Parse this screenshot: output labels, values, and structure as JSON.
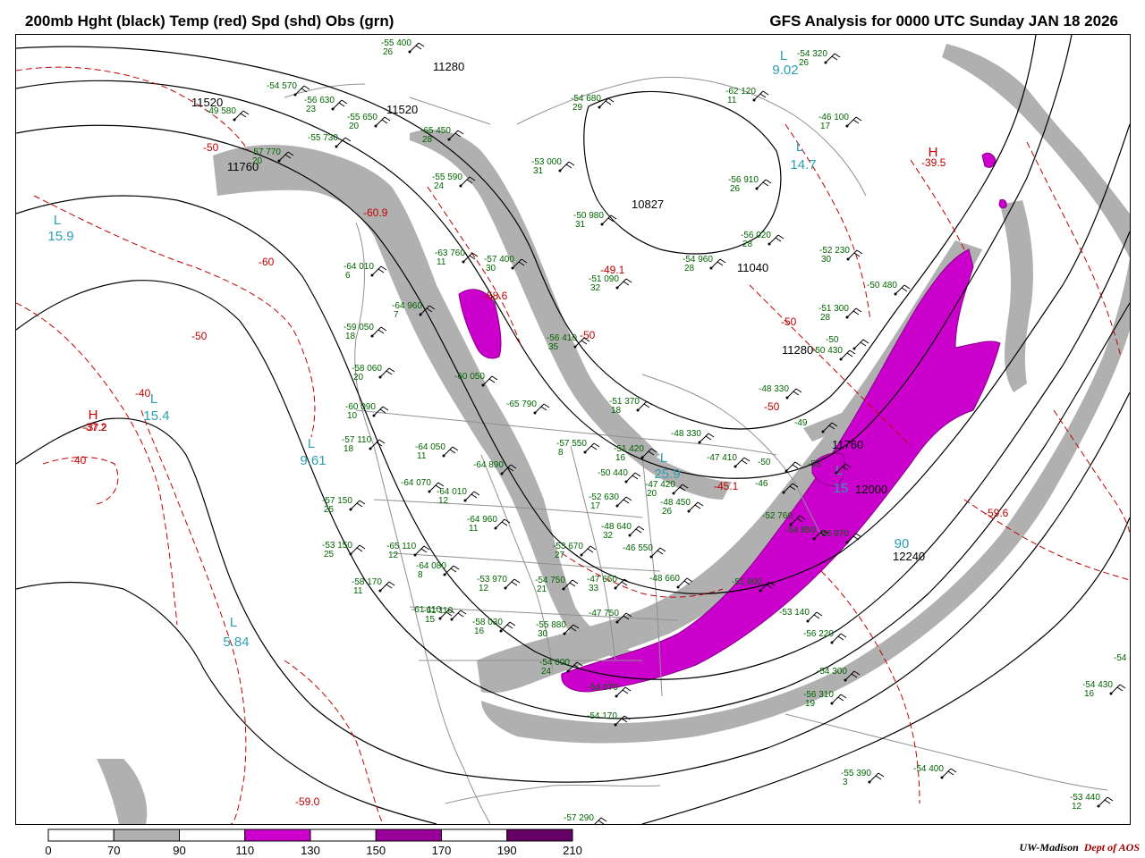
{
  "title_left": "200mb Hght (black) Temp (red) Spd (shd) Obs (grn)",
  "title_right": "GFS Analysis for 0000 UTC Sunday  JAN 18 2026",
  "credit": {
    "org": "UW-Madison",
    "dept": "Dept of AOS"
  },
  "colors": {
    "height": "#000000",
    "temp": "#c00000",
    "obs": "#006400",
    "low_high": "#2aa0b0",
    "shade_70": "#b0b0b0",
    "shade_110": "#cc00cc",
    "shade_150": "#990099",
    "shade_190": "#660066"
  },
  "colorbar": {
    "ticks": [
      "0",
      "70",
      "90",
      "110",
      "130",
      "150",
      "170",
      "190",
      "210"
    ],
    "fills": [
      "#ffffff",
      "#b0b0b0",
      "#ffffff",
      "#cc00cc",
      "#ffffff",
      "#990099",
      "#ffffff",
      "#660066"
    ]
  },
  "height_labels": [
    "11280",
    "11520",
    "11520",
    "11760",
    "10827",
    "11040",
    "11280",
    "11760",
    "12000",
    "12240"
  ],
  "temp_labels": [
    "-50",
    "-60",
    "-50",
    "-40",
    "-40",
    "-50",
    "-50",
    "-37.2",
    "-39.5",
    "-59.6",
    "-45.1",
    "-59.0",
    "-60.9",
    "-58.6",
    "-50",
    "-49.1"
  ],
  "lows_highs": [
    {
      "letter": "L",
      "value": "15.9"
    },
    {
      "letter": "L",
      "value": "15.4"
    },
    {
      "letter": "L",
      "value": "9.61"
    },
    {
      "letter": "L",
      "value": "5.84"
    },
    {
      "letter": "L",
      "value": "14.7"
    },
    {
      "letter": "L",
      "value": "9.02"
    },
    {
      "letter": "L",
      "value": "25.9"
    },
    {
      "letter": "L",
      "value": "15"
    },
    {
      "letter": "L",
      "value": "90"
    },
    {
      "letter": "H",
      "value": "-37.2"
    },
    {
      "letter": "H",
      "value": "-39.5"
    }
  ],
  "obs": [
    {
      "temp": "-55",
      "hgt": "400",
      "dew": "26"
    },
    {
      "temp": "-54",
      "hgt": "570",
      "dew": ""
    },
    {
      "temp": "-56",
      "hgt": "630",
      "dew": "23"
    },
    {
      "temp": "-49",
      "hgt": "580",
      "dew": ""
    },
    {
      "temp": "-55",
      "hgt": "650",
      "dew": "20"
    },
    {
      "temp": "-55",
      "hgt": "730",
      "dew": ""
    },
    {
      "temp": "-57",
      "hgt": "770",
      "dew": "20"
    },
    {
      "temp": "-65",
      "hgt": "450",
      "dew": "28"
    },
    {
      "temp": "-55",
      "hgt": "590",
      "dew": "24"
    },
    {
      "temp": "-53",
      "hgt": "000",
      "dew": "31"
    },
    {
      "temp": "-54",
      "hgt": "680",
      "dew": "29"
    },
    {
      "temp": "-62",
      "hgt": "120",
      "dew": "11"
    },
    {
      "temp": "-54",
      "hgt": "320",
      "dew": "26"
    },
    {
      "temp": "-46",
      "hgt": "100",
      "dew": "17"
    },
    {
      "temp": "-56",
      "hgt": "910",
      "dew": "26"
    },
    {
      "temp": "-50",
      "hgt": "980",
      "dew": "31"
    },
    {
      "temp": "-56",
      "hgt": "020",
      "dew": "28"
    },
    {
      "temp": "-52",
      "hgt": "230",
      "dew": "30"
    },
    {
      "temp": "-54",
      "hgt": "960",
      "dew": "28"
    },
    {
      "temp": "-51",
      "hgt": "090",
      "dew": "32"
    },
    {
      "temp": "-63",
      "hgt": "760",
      "dew": "11"
    },
    {
      "temp": "-57",
      "hgt": "400",
      "dew": "30"
    },
    {
      "temp": "-64",
      "hgt": "010",
      "dew": "6"
    },
    {
      "temp": "-64",
      "hgt": "960",
      "dew": "7"
    },
    {
      "temp": "-59",
      "hgt": "050",
      "dew": "18"
    },
    {
      "temp": "-58",
      "hgt": "060",
      "dew": "20"
    },
    {
      "temp": "-60",
      "hgt": "090",
      "dew": "10"
    },
    {
      "temp": "-57",
      "hgt": "110",
      "dew": "18"
    },
    {
      "temp": "-64",
      "hgt": "050",
      "dew": "11"
    },
    {
      "temp": "-64",
      "hgt": "890",
      "dew": ""
    },
    {
      "temp": "-65",
      "hgt": "790",
      "dew": ""
    },
    {
      "temp": "-56",
      "hgt": "410",
      "dew": "35"
    },
    {
      "temp": "-51",
      "hgt": "370",
      "dew": "18"
    },
    {
      "temp": "-57",
      "hgt": "550",
      "dew": "8"
    },
    {
      "temp": "-51",
      "hgt": "420",
      "dew": "16"
    },
    {
      "temp": "-50",
      "hgt": "440",
      "dew": ""
    },
    {
      "temp": "-48",
      "hgt": "330",
      "dew": ""
    },
    {
      "temp": "-47",
      "hgt": "410",
      "dew": ""
    },
    {
      "temp": "-51",
      "hgt": "300",
      "dew": "28"
    },
    {
      "temp": "-50",
      "hgt": "480",
      "dew": ""
    },
    {
      "temp": "-50",
      "hgt": "430",
      "dew": ""
    },
    {
      "temp": "-48",
      "hgt": "330",
      "dew": ""
    },
    {
      "temp": "-49",
      "hgt": "",
      "dew": ""
    },
    {
      "temp": "-64",
      "hgt": "070",
      "dew": ""
    },
    {
      "temp": "-64",
      "hgt": "010",
      "dew": "12"
    },
    {
      "temp": "-61",
      "hgt": "110",
      "dew": ""
    },
    {
      "temp": "-57",
      "hgt": "150",
      "dew": "25"
    },
    {
      "temp": "-53",
      "hgt": "150",
      "dew": "25"
    },
    {
      "temp": "-65",
      "hgt": "110",
      "dew": "12"
    },
    {
      "temp": "-64",
      "hgt": "080",
      "dew": "8"
    },
    {
      "temp": "-64",
      "hgt": "960",
      "dew": "11"
    },
    {
      "temp": "-52",
      "hgt": "630",
      "dew": "17"
    },
    {
      "temp": "-47",
      "hgt": "420",
      "dew": "20"
    },
    {
      "temp": "-48",
      "hgt": "450",
      "dew": "26"
    },
    {
      "temp": "-48",
      "hgt": "640",
      "dew": "32"
    },
    {
      "temp": "-53",
      "hgt": "670",
      "dew": "27"
    },
    {
      "temp": "-46",
      "hgt": "550",
      "dew": ""
    },
    {
      "temp": "-58",
      "hgt": "170",
      "dew": "11"
    },
    {
      "temp": "-53",
      "hgt": "970",
      "dew": "12"
    },
    {
      "temp": "-54",
      "hgt": "750",
      "dew": "21"
    },
    {
      "temp": "-47",
      "hgt": "650",
      "dew": "33"
    },
    {
      "temp": "-48",
      "hgt": "660",
      "dew": ""
    },
    {
      "temp": "-51",
      "hgt": "900",
      "dew": ""
    },
    {
      "temp": "-61",
      "hgt": "110",
      "dew": "15"
    },
    {
      "temp": "-58",
      "hgt": "030",
      "dew": "16"
    },
    {
      "temp": "-47",
      "hgt": "750",
      "dew": ""
    },
    {
      "temp": "-54",
      "hgt": "000",
      "dew": "24"
    },
    {
      "temp": "-54",
      "hgt": "070",
      "dew": ""
    },
    {
      "temp": "-54",
      "hgt": "170",
      "dew": ""
    },
    {
      "temp": "-53",
      "hgt": "140",
      "dew": ""
    },
    {
      "temp": "-56",
      "hgt": "220",
      "dew": ""
    },
    {
      "temp": "-54",
      "hgt": "300",
      "dew": ""
    },
    {
      "temp": "-56",
      "hgt": "310",
      "dew": "19"
    },
    {
      "temp": "-54",
      "hgt": "430",
      "dew": "16"
    },
    {
      "temp": "-54",
      "hgt": "400",
      "dew": ""
    },
    {
      "temp": "-55",
      "hgt": "390",
      "dew": "3"
    },
    {
      "temp": "-53",
      "hgt": "440",
      "dew": "12"
    },
    {
      "temp": "-57",
      "hgt": "290",
      "dew": ""
    },
    {
      "temp": "-52",
      "hgt": "760",
      "dew": ""
    },
    {
      "temp": "-54",
      "hgt": "850",
      "dew": ""
    },
    {
      "temp": "-56",
      "hgt": "970",
      "dew": ""
    },
    {
      "temp": "-54",
      "hgt": "4",
      "dew": ""
    },
    {
      "temp": "-55",
      "hgt": "880",
      "dew": "30"
    },
    {
      "temp": "-53",
      "hgt": "",
      "dew": ""
    },
    {
      "temp": "-50",
      "hgt": "",
      "dew": ""
    },
    {
      "temp": "-46",
      "hgt": "",
      "dew": ""
    },
    {
      "temp": "-60",
      "hgt": "050",
      "dew": ""
    },
    {
      "temp": "-50",
      "hgt": "",
      "dew": ""
    }
  ]
}
